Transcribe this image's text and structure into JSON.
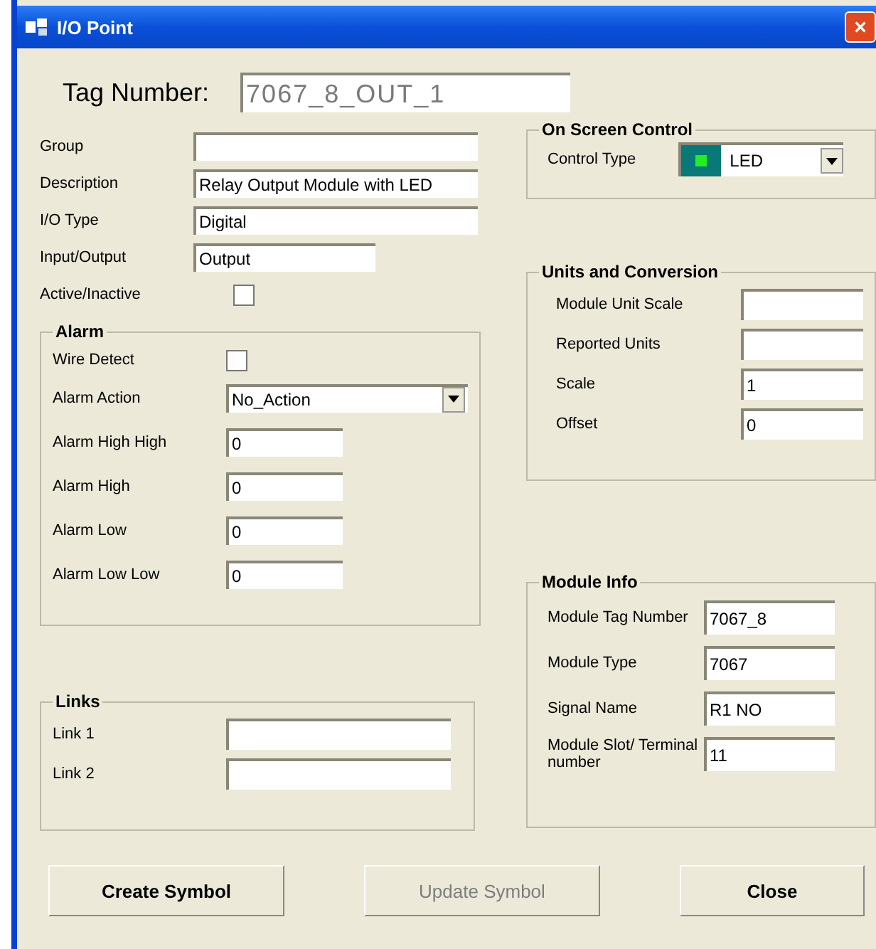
{
  "window": {
    "title": "I/O Point",
    "close": "×"
  },
  "tag_number": {
    "label": "Tag Number:",
    "value": "7067_8_OUT_1",
    "disabled": true
  },
  "fields": [
    {
      "kind": "text",
      "label": "Group"
    },
    {
      "kind": "text",
      "label": "Description",
      "value": "Relay Output Module with LED"
    },
    {
      "kind": "text",
      "label": "I/O Type",
      "value": "Digital"
    },
    {
      "kind": "short",
      "label": "Input/Output",
      "value": "Output"
    },
    {
      "kind": "checkbox",
      "label": "Active/Inactive",
      "checked": false
    }
  ],
  "alarm": {
    "title": "Alarm",
    "items": [
      {
        "kind": "checkbox",
        "label": "Wire Detect",
        "checked": false
      },
      {
        "kind": "select",
        "label": "Alarm Action",
        "value": "No_Action"
      },
      {
        "kind": "text",
        "label": "Alarm High High",
        "value": "0"
      },
      {
        "kind": "text",
        "label": "Alarm High",
        "value": "0"
      },
      {
        "kind": "text",
        "label": "Alarm Low",
        "value": "0"
      },
      {
        "kind": "text",
        "label": "Alarm Low Low",
        "value": "0"
      }
    ]
  },
  "links": {
    "title": "Links",
    "items": [
      {
        "label": "Link 1"
      },
      {
        "label": "Link 2"
      }
    ]
  },
  "on_screen_control": {
    "title": "On Screen Control",
    "label": "Control Type",
    "value": "LED"
  },
  "units": {
    "title": "Units and Conversion",
    "items": [
      {
        "label": "Module Unit Scale"
      },
      {
        "label": "Reported Units"
      },
      {
        "label": "Scale",
        "value": "1"
      },
      {
        "label": "Offset",
        "value": "0"
      }
    ]
  },
  "module_info": {
    "title": "Module Info",
    "items": [
      {
        "label": "Module Tag Number",
        "value": "7067_8"
      },
      {
        "label": "Module Type",
        "value": "7067"
      },
      {
        "label": "Signal Name",
        "value": "R1 NO"
      },
      {
        "label": "Module Slot/ Terminal number",
        "value": "11"
      }
    ]
  },
  "buttons": [
    {
      "label": "Create Symbol",
      "disabled": false
    },
    {
      "label": "Update Symbol",
      "disabled": true
    },
    {
      "label": "Close",
      "disabled": false
    }
  ]
}
